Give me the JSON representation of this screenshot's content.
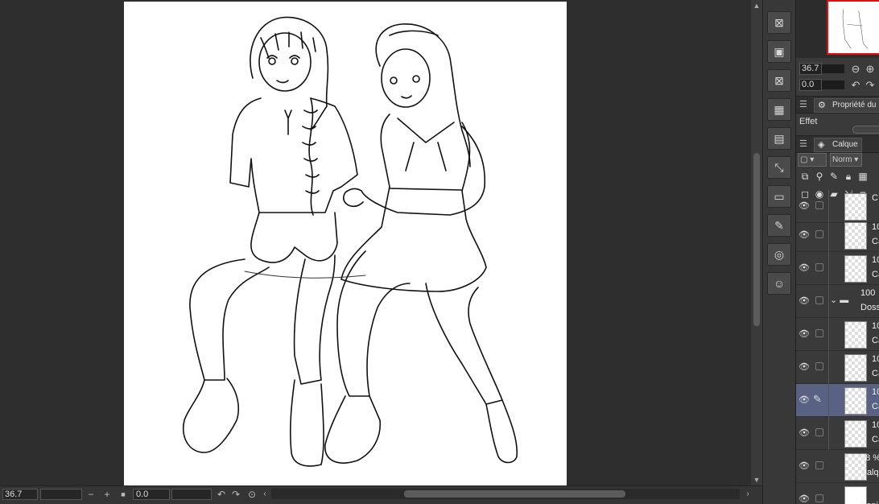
{
  "canvas": {
    "zoom": "36.7",
    "rotation": "0.0"
  },
  "navigator": {
    "zoom": "36.7",
    "rotation": "0.0"
  },
  "panels": {
    "property_tab": "Propriété du",
    "effect_label": "Effet",
    "layer_tab": "Calque",
    "blend_mode": "Norm"
  },
  "layers": [
    {
      "name1": "C",
      "name2": "",
      "partial": true
    },
    {
      "name1": "10",
      "name2": "Ca"
    },
    {
      "name1": "10",
      "name2": "Ca"
    },
    {
      "name1": "100",
      "name2": "Doss",
      "folder": true
    },
    {
      "name1": "10",
      "name2": "Ca"
    },
    {
      "name1": "10",
      "name2": "Ca"
    },
    {
      "name1": "10",
      "name2": "Ca",
      "selected": true
    },
    {
      "name1": "10",
      "name2": "Ca"
    },
    {
      "name1": "18 %",
      "name2": "Calqu"
    },
    {
      "name1": "",
      "name2": "Papie"
    }
  ],
  "colors": {
    "selected_layer": "#5a6283",
    "navigator_frame": "#dd1111"
  }
}
